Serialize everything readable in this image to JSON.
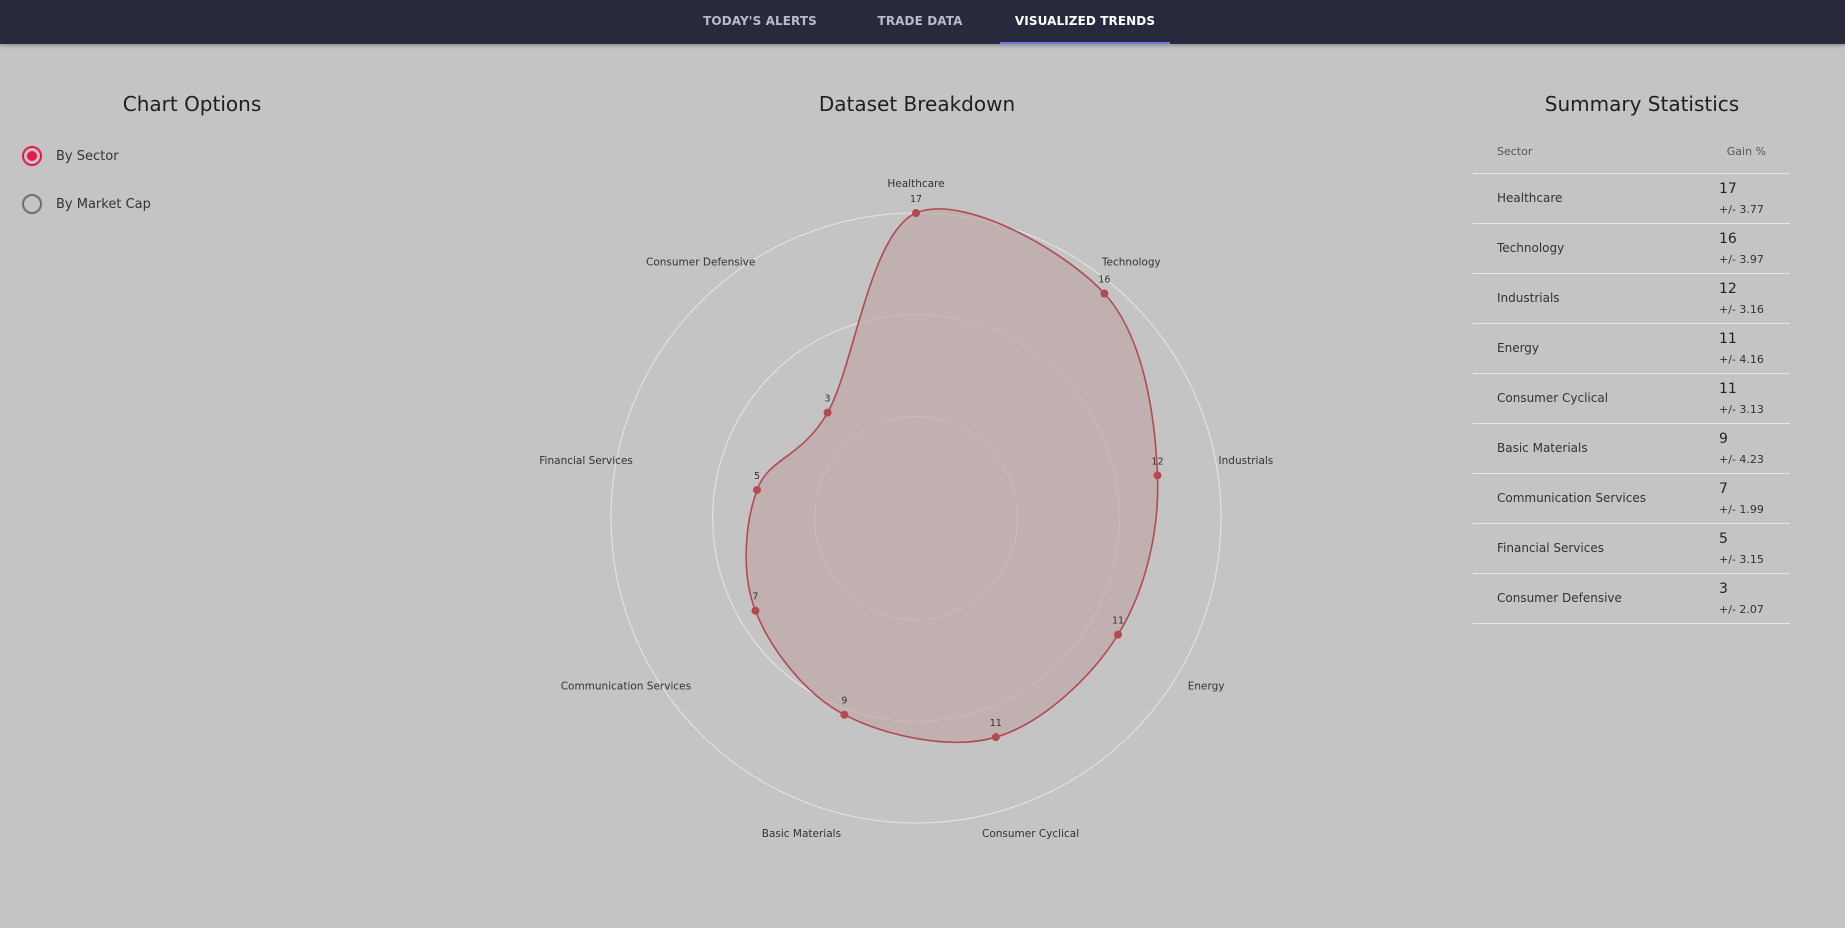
{
  "nav": {
    "tabs": [
      {
        "label": "TODAY'S ALERTS",
        "active": false
      },
      {
        "label": "TRADE DATA",
        "active": false
      },
      {
        "label": "VISUALIZED TRENDS",
        "active": true
      }
    ]
  },
  "options": {
    "title": "Chart Options",
    "choices": [
      {
        "label": "By Sector",
        "checked": true
      },
      {
        "label": "By Market Cap",
        "checked": false
      }
    ]
  },
  "breakdown": {
    "title": "Dataset Breakdown"
  },
  "colors": {
    "series": "#b34a4f",
    "fill": "#c0aaaa",
    "accent": "#e8184c",
    "nav_bg": "#262a3c",
    "tab_underline": "#6b7be0"
  },
  "chart_data": {
    "type": "radar",
    "title": "Dataset Breakdown",
    "categories": [
      "Healthcare",
      "Technology",
      "Industrials",
      "Energy",
      "Consumer Cyclical",
      "Basic Materials",
      "Communication Services",
      "Financial Services",
      "Consumer Defensive"
    ],
    "values": [
      17,
      16,
      12,
      11,
      11,
      9,
      7,
      5,
      3
    ],
    "rlim": [
      0,
      17
    ],
    "grid": true,
    "legend": "none"
  },
  "stats": {
    "title": "Summary Statistics",
    "col_sector": "Sector",
    "col_gain": "Gain %",
    "rows": [
      {
        "sector": "Healthcare",
        "gain": "17",
        "err": "+/- 3.77"
      },
      {
        "sector": "Technology",
        "gain": "16",
        "err": "+/- 3.97"
      },
      {
        "sector": "Industrials",
        "gain": "12",
        "err": "+/- 3.16"
      },
      {
        "sector": "Energy",
        "gain": "11",
        "err": "+/- 4.16"
      },
      {
        "sector": "Consumer Cyclical",
        "gain": "11",
        "err": "+/- 3.13"
      },
      {
        "sector": "Basic Materials",
        "gain": "9",
        "err": "+/- 4.23"
      },
      {
        "sector": "Communication Services",
        "gain": "7",
        "err": "+/- 1.99"
      },
      {
        "sector": "Financial Services",
        "gain": "5",
        "err": "+/- 3.15"
      },
      {
        "sector": "Consumer Defensive",
        "gain": "3",
        "err": "+/- 2.07"
      }
    ]
  }
}
